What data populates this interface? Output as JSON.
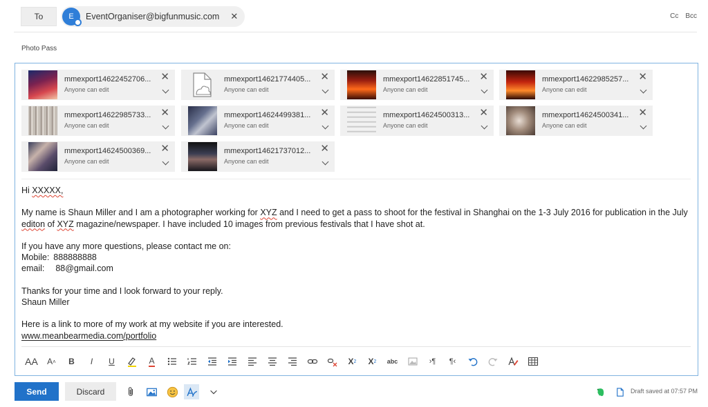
{
  "to_row": {
    "to_label": "To",
    "recipient_initial": "E",
    "recipient_email": "EventOrganiser@bigfunmusic.com",
    "remove_symbol": "✕",
    "cc_label": "Cc",
    "bcc_label": "Bcc"
  },
  "subject": "Photo Pass",
  "attachments": [
    {
      "name": "mmexport14622452706...",
      "permission": "Anyone can edit"
    },
    {
      "name": "mmexport14621774405...",
      "permission": "Anyone can edit"
    },
    {
      "name": "mmexport14622851745...",
      "permission": "Anyone can edit"
    },
    {
      "name": "mmexport14622985257...",
      "permission": "Anyone can edit"
    },
    {
      "name": "mmexport14622985733...",
      "permission": "Anyone can edit"
    },
    {
      "name": "mmexport14624499381...",
      "permission": "Anyone can edit"
    },
    {
      "name": "mmexport14624500313...",
      "permission": "Anyone can edit"
    },
    {
      "name": "mmexport14624500341...",
      "permission": "Anyone can edit"
    },
    {
      "name": "mmexport14624500369...",
      "permission": "Anyone can edit"
    },
    {
      "name": "mmexport14621737012...",
      "permission": "Anyone can edit"
    }
  ],
  "body": {
    "greeting_prefix": "Hi ",
    "greeting_name": "XXXXX,",
    "para1_a": "My name is Shaun Miller and I am a photographer working for ",
    "para1_xyz": "XYZ",
    "para1_b": " and I need to get a pass to shoot for the festival in Shanghai on the 1-3 July 2016 for publication in the July ",
    "para1_editon": "editon",
    "para1_c": " of ",
    "para1_xyz2": "XYZ",
    "para1_d": " magazine/newspaper. I have included 10 images from previous festivals that I have shot at.",
    "contact_intro": "If you have any more questions, please contact me on:",
    "mobile_label": "Mobile:",
    "mobile_value": "888888888",
    "email_label": "email:",
    "email_value": "88@gmail.com",
    "thanks": "Thanks for your time and I look forward to your reply.",
    "signature": "Shaun Miller",
    "link_intro": "Here is a link to more of my work at my website if you are interested.",
    "link_domain": "www.meanbearmedia.com",
    "link_path": "/portfolio"
  },
  "format_toolbar": {
    "font_size_label": "AA",
    "grow_label": "A",
    "bold_label": "B",
    "italic_label": "I",
    "underline_label": "U",
    "font_color_label": "A",
    "superscript_label": "X",
    "subscript_label": "X",
    "strikethrough_label": "abc"
  },
  "actions": {
    "send_label": "Send",
    "discard_label": "Discard",
    "draft_status": "Draft saved at 07:57 PM"
  },
  "colors": {
    "accent": "#2172c9",
    "frame_border": "#7fb3e0",
    "evernote_green": "#2dbe60"
  }
}
